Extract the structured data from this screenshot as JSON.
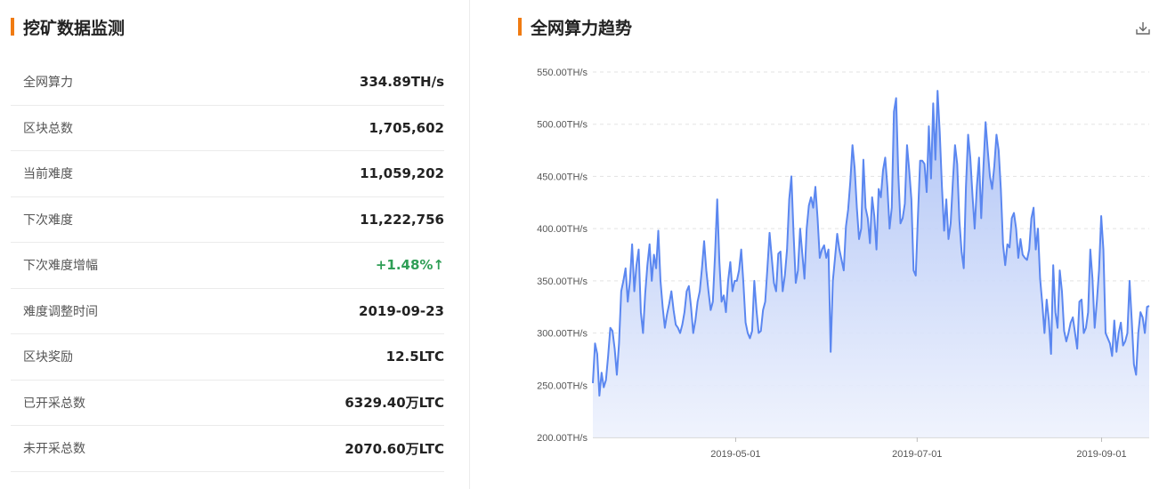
{
  "left_panel": {
    "title": "挖矿数据监测",
    "stats": [
      {
        "label": "全网算力",
        "value": "334.89TH/s",
        "trend": "neutral"
      },
      {
        "label": "区块总数",
        "value": "1,705,602",
        "trend": "neutral"
      },
      {
        "label": "当前难度",
        "value": "11,059,202",
        "trend": "neutral"
      },
      {
        "label": "下次难度",
        "value": "11,222,756",
        "trend": "neutral"
      },
      {
        "label": "下次难度增幅",
        "value": "+1.48%↑",
        "trend": "up"
      },
      {
        "label": "难度调整时间",
        "value": "2019-09-23",
        "trend": "neutral"
      },
      {
        "label": "区块奖励",
        "value": "12.5LTC",
        "trend": "neutral"
      },
      {
        "label": "已开采总数",
        "value": "6329.40万LTC",
        "trend": "neutral"
      },
      {
        "label": "未开采总数",
        "value": "2070.60万LTC",
        "trend": "neutral"
      }
    ]
  },
  "right_panel": {
    "title": "全网算力趋势",
    "download_icon": "download-icon"
  },
  "colors": {
    "accent": "#f07b12",
    "line": "#5b87f0",
    "area_top": "#a9bff5",
    "area_bottom": "#eef2fd",
    "positive": "#2f9e56"
  },
  "chart_data": {
    "type": "area",
    "x_start": "2019-03-14",
    "x_end": "2019-09-17",
    "x_ticks": [
      "2019-05-01",
      "2019-07-01",
      "2019-09-01"
    ],
    "y_ticks": [
      "200.00TH/s",
      "250.00TH/s",
      "300.00TH/s",
      "350.00TH/s",
      "400.00TH/s",
      "450.00TH/s",
      "500.00TH/s",
      "550.00TH/s"
    ],
    "ylim": [
      200,
      550
    ],
    "y_unit": "TH/s",
    "grid": true,
    "values": [
      252,
      290,
      280,
      240,
      262,
      248,
      255,
      278,
      305,
      302,
      285,
      260,
      290,
      340,
      350,
      362,
      330,
      350,
      385,
      340,
      365,
      380,
      320,
      300,
      338,
      365,
      385,
      350,
      375,
      362,
      398,
      350,
      325,
      305,
      318,
      328,
      340,
      322,
      308,
      305,
      300,
      308,
      320,
      340,
      345,
      325,
      300,
      312,
      330,
      340,
      362,
      388,
      360,
      340,
      322,
      330,
      375,
      428,
      368,
      330,
      336,
      320,
      350,
      368,
      340,
      350,
      350,
      360,
      380,
      348,
      310,
      300,
      295,
      302,
      350,
      322,
      300,
      302,
      322,
      330,
      362,
      396,
      372,
      348,
      340,
      376,
      378,
      340,
      355,
      380,
      428,
      450,
      395,
      348,
      360,
      400,
      376,
      352,
      400,
      422,
      430,
      420,
      440,
      410,
      372,
      380,
      384,
      372,
      380,
      282,
      350,
      372,
      395,
      380,
      370,
      360,
      402,
      418,
      445,
      480,
      458,
      420,
      390,
      400,
      466,
      420,
      410,
      386,
      430,
      412,
      380,
      438,
      430,
      456,
      468,
      440,
      400,
      420,
      512,
      525,
      452,
      405,
      410,
      424,
      480,
      456,
      428,
      360,
      355,
      412,
      465,
      465,
      462,
      435,
      498,
      448,
      520,
      466,
      532,
      492,
      440,
      398,
      428,
      390,
      405,
      445,
      480,
      462,
      408,
      378,
      362,
      440,
      490,
      468,
      432,
      400,
      440,
      468,
      410,
      458,
      502,
      475,
      450,
      438,
      460,
      490,
      475,
      438,
      385,
      365,
      385,
      382,
      410,
      415,
      400,
      372,
      390,
      375,
      372,
      370,
      380,
      410,
      420,
      380,
      400,
      352,
      328,
      300,
      332,
      312,
      280,
      365,
      320,
      305,
      360,
      340,
      302,
      292,
      300,
      310,
      315,
      300,
      285,
      330,
      332,
      300,
      305,
      320,
      380,
      352,
      305,
      330,
      360,
      412,
      380,
      300,
      295,
      290,
      278,
      312,
      282,
      300,
      310,
      288,
      292,
      300,
      350,
      312,
      270,
      260,
      300,
      320,
      315,
      300,
      325,
      326
    ]
  }
}
